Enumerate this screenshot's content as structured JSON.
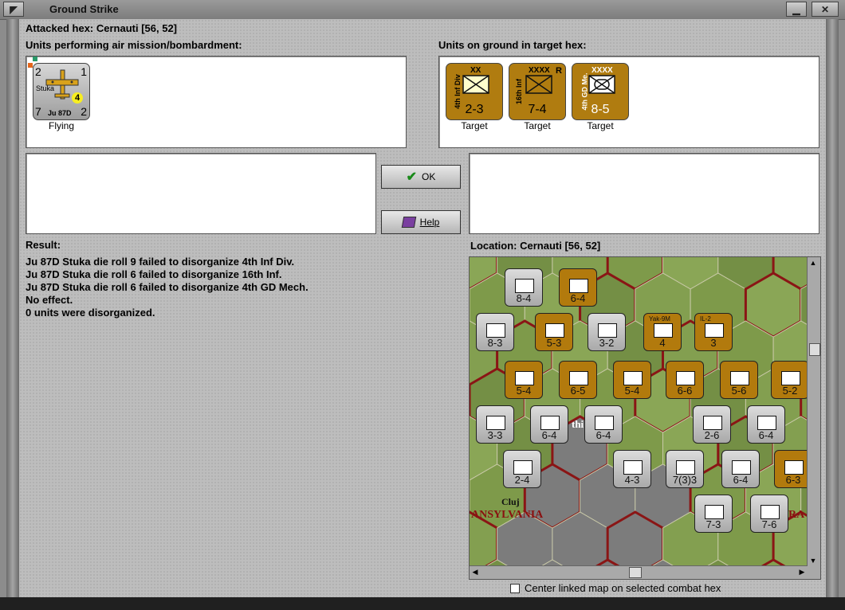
{
  "window": {
    "title": "Ground Strike"
  },
  "header": {
    "attacked_hex": "Attacked hex: Cernauti  [56, 52]"
  },
  "air_units": {
    "label": "Units performing air mission/bombardment:",
    "items": [
      {
        "name": "Stuka",
        "type": "Ju 87D",
        "top_left": "2",
        "top_right": "1",
        "bottom_left": "7",
        "bottom_right": "2",
        "badge": "4",
        "status": "Flying"
      }
    ]
  },
  "ground_units": {
    "label": "Units on ground in target hex:",
    "items": [
      {
        "name": "4th Inf Div",
        "size": "XX",
        "value": "2-3",
        "status": "Target"
      },
      {
        "name": "16th Inf",
        "size": "XXXX",
        "extra": "R",
        "value": "7-4",
        "status": "Target"
      },
      {
        "name": "4th GD Me.",
        "size": "XXXX",
        "value": "8-5",
        "status": "Target"
      }
    ]
  },
  "buttons": {
    "ok": "OK",
    "help": "Help"
  },
  "result": {
    "label": "Result:",
    "lines": [
      "Ju 87D Stuka die roll 9 failed to disorganize 4th Inf Div.",
      "Ju 87D Stuka die roll 6 failed to disorganize 16th Inf.",
      "Ju 87D Stuka die roll 6 failed to disorganize 4th GD Mech.",
      "No effect.",
      "0 units were disorganized."
    ]
  },
  "location": {
    "label": "Location:  Cernauti  [56, 52]"
  },
  "map": {
    "labels": {
      "cluj": "Cluj",
      "region": "ANSYLVANIA",
      "ra": "RA",
      "thi": "thi"
    },
    "units": [
      {
        "value": "8-4",
        "color": "gray"
      },
      {
        "value": "6-4",
        "color": "brown"
      },
      {
        "value": "8-3",
        "color": "gray"
      },
      {
        "value": "5-3",
        "color": "brown"
      },
      {
        "value": "3-2",
        "color": "gray"
      },
      {
        "value": "4",
        "color": "brown",
        "label": "Yak-9M"
      },
      {
        "value": "3",
        "color": "brown",
        "label": "IL-2"
      },
      {
        "value": "5-4",
        "color": "brown"
      },
      {
        "value": "6-5",
        "color": "brown"
      },
      {
        "value": "5-4",
        "color": "brown"
      },
      {
        "value": "6-6",
        "color": "brown"
      },
      {
        "value": "5-6",
        "color": "brown"
      },
      {
        "value": "5-2",
        "color": "brown"
      },
      {
        "value": "3-3",
        "color": "gray"
      },
      {
        "value": "6-4",
        "color": "gray"
      },
      {
        "value": "6-4",
        "color": "gray"
      },
      {
        "value": "2-6",
        "color": "gray"
      },
      {
        "value": "6-4",
        "color": "gray"
      },
      {
        "value": "2-4",
        "color": "gray"
      },
      {
        "value": "4-3",
        "color": "gray"
      },
      {
        "value": "7(3)3",
        "color": "gray"
      },
      {
        "value": "6-4",
        "color": "gray"
      },
      {
        "value": "6-3",
        "color": "brown"
      },
      {
        "value": "7-3",
        "color": "gray"
      },
      {
        "value": "7-6",
        "color": "gray"
      }
    ]
  },
  "center_option": {
    "label": "Center linked map on selected combat hex",
    "checked": false
  }
}
